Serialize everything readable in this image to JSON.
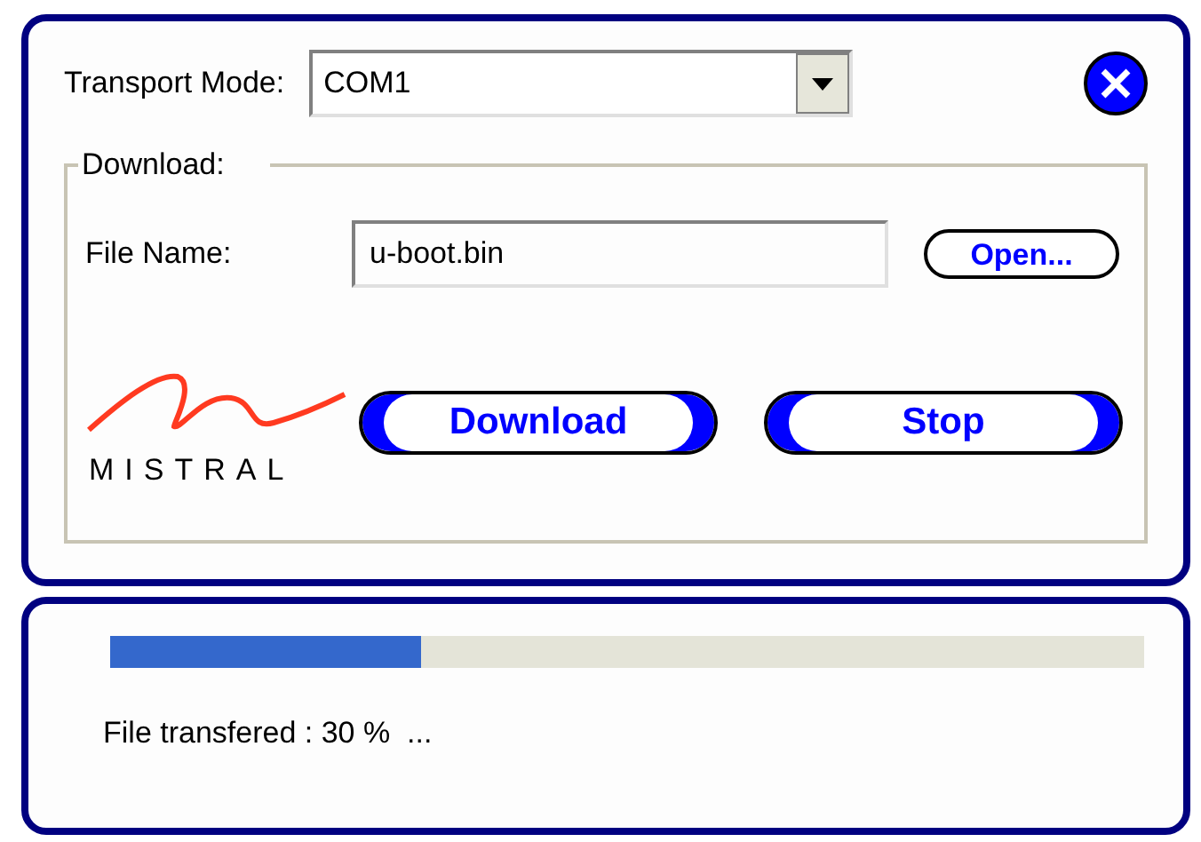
{
  "transport": {
    "label": "Transport Mode:",
    "value": "COM1"
  },
  "download": {
    "legend": "Download:",
    "file_label": "File Name:",
    "file_value": "u-boot.bin",
    "open_button": "Open..."
  },
  "logo": {
    "text": "MISTRAL"
  },
  "buttons": [
    "Download",
    "Stop"
  ],
  "progress": {
    "level": 0.3,
    "status": "File transfered : 30 %  ..."
  }
}
